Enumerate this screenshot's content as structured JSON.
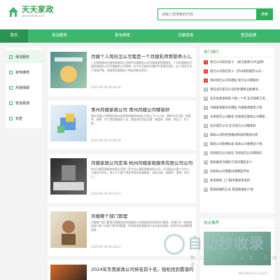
{
  "header": {
    "logo_title": "天天家政",
    "logo_sub": "www.ttdaoli.com",
    "search_placeholder": "请输入您搜索的内容",
    "search_button": "搜索"
  },
  "nav": [
    "首页",
    "保洁服务",
    "家电维修",
    "月嫂保姆",
    "管道疏通"
  ],
  "sidebar": [
    "保洁服务",
    "家电维修",
    "月嫂保姆",
    "管道疏通",
    "标签"
  ],
  "articles": [
    {
      "title": "月嫂个人简历怎么写我是一个月嫂乳师育婴师小儿…",
      "desc": "广州家政服务月嫂家政服务公司提供月嫂服务公司月嫂育婴师等服务，广州家政服务月嫂家政服务公司月嫂服务公司简单一次专业且经验丰富的专家顾问团队，这个团队专长于母婴护理，我推荐您查看这个地区的相关资讯…",
      "date": "2024-09-30 06:20:44"
    },
    {
      "title": "青州月嫂家政公司 青州月嫂公司哪家好",
      "desc": "青州月嫂公司哪家好青州金牌家政服务有限公司成立于2014年，拥有专业月嫂、育婴师、保姆、护工等家政服务人员，服务项目包括月嫂、育婴师、保姆、钟点工、护工等…",
      "date": "2024-09-30 01:06:53"
    },
    {
      "title": "月嫂家政公司定海 杭州月嫂家政服务有限公司公司理念",
      "desc": "杭州月嫂家政服务有限公司是一家专业从事家政服务的公司，公司理念以客户为中心，以服务为宗旨，致力于为客户提供优质的家政服务，包括月嫂、育婴师、保姆、钟点工…",
      "date": "2024-09-30 00:32:11"
    },
    {
      "title": "月嫂哪个部门管理",
      "desc": "月嫂哪个部门管理月嫂服务由家政服务公司或者相关机构进行管理，月嫂行业一般由商务部门和人社部门等共同管理，同时各地家政服务行业协会也承担一定的行业自律管理职责…",
      "date": "2024-09-30 00:13:21"
    },
    {
      "title": "2024年东莞家政公司排名前十名，轻松找到靠谱的家政服务",
      "desc": "",
      "date": ""
    }
  ],
  "hot_list": {
    "title": "热门排行",
    "items": [
      "保洁公司排名前十 （保洁家政10大品牌）",
      "保洁公司排名前十（苏州家政服务公司…",
      "漳州保洁公司有哪些 保洁公司哪家好",
      "清洗北京保洁公司的步骤和注意事项…",
      "北京住家保姆多少钱一个月 北京保姆工资…",
      "月嫂家政服务有哪些 月嫂家政服务介绍",
      "天津保洁公司推荐 优质保洁家政公司哪家…",
      "北京保洁公司 北京保洁公司哪家好",
      "家政公司的经营模式和盈利模式分析",
      "家政公司收费标准 家政公司收费多少钱",
      "深圳保洁公司排名 深圳保洁公司哪家好",
      "家政服务月嫂的工资待遇是多少",
      "开家政公司需要办理哪些手续",
      "家电维修 上门服务维修家电的…",
      "管道疏通的方法 管道疏通多少钱"
    ]
  },
  "recommend": {
    "title": "热点推荐",
    "date": "2024-09-22 12:32:11"
  },
  "watermark": {
    "logo": "自动秒收录",
    "sub": "数 上 链 接 · 来 这 里 · 自 动 收"
  },
  "colors": {
    "brand_green": "#3db76b",
    "dark_green": "#2a9352",
    "hot_red": "#e33333"
  }
}
